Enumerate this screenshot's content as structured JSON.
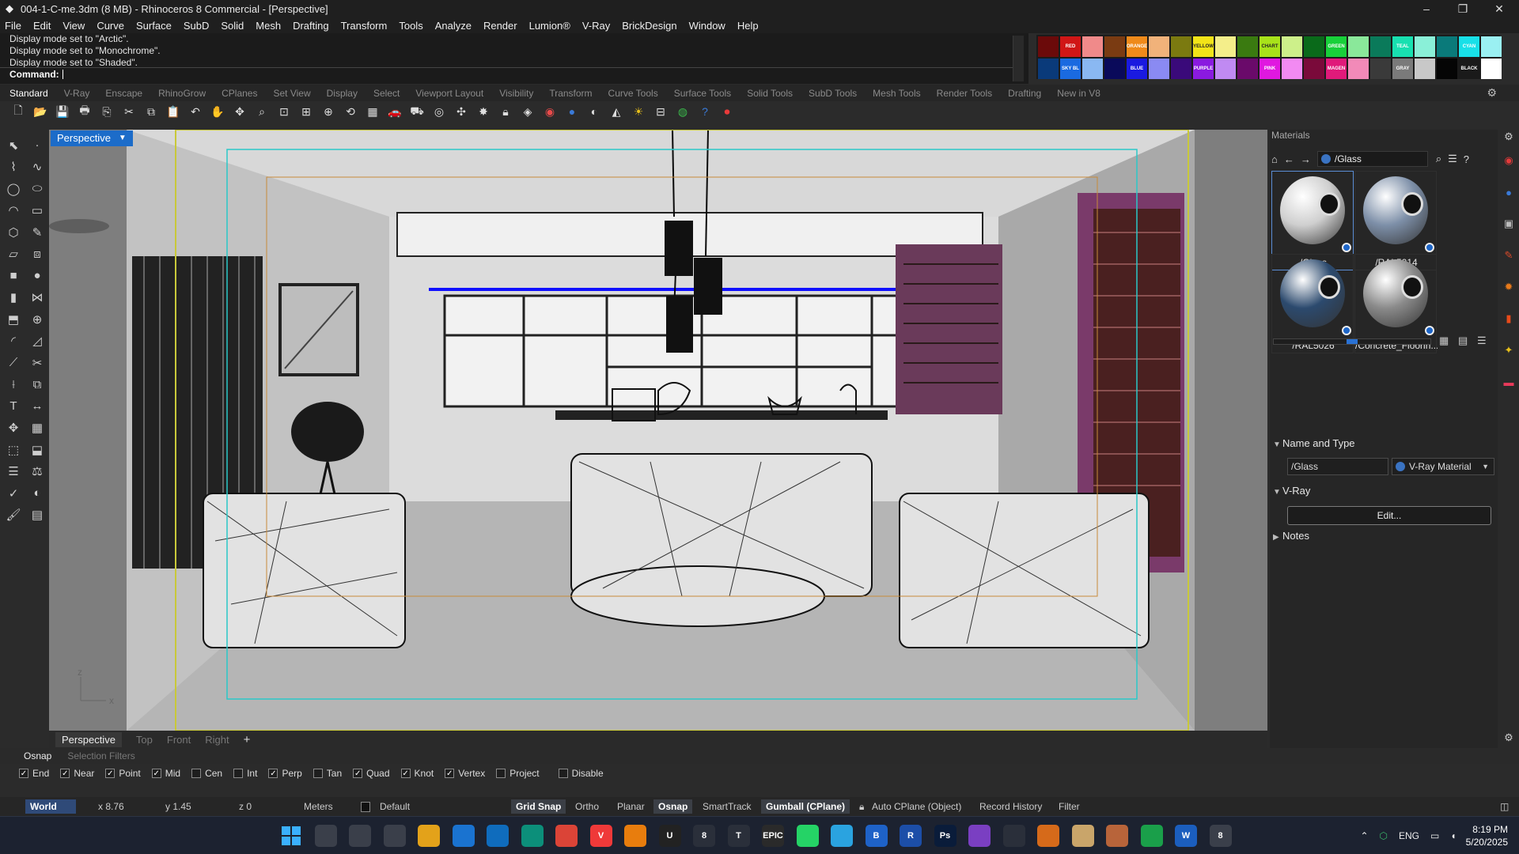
{
  "window": {
    "title": "004-1-C-me.3dm (8 MB) - Rhinoceros 8 Commercial - [Perspective]",
    "controls": [
      "–",
      "❐",
      "✕"
    ]
  },
  "menu": [
    "File",
    "Edit",
    "View",
    "Curve",
    "Surface",
    "SubD",
    "Solid",
    "Mesh",
    "Drafting",
    "Transform",
    "Tools",
    "Analyze",
    "Render",
    "Lumion®",
    "V-Ray",
    "BrickDesign",
    "Window",
    "Help"
  ],
  "command": {
    "history": [
      "Display mode set to \"Arctic\".",
      "Display mode set to \"Monochrome\".",
      "Display mode set to \"Shaded\"."
    ],
    "prompt": "Command:"
  },
  "swatches": {
    "row1": [
      {
        "c": "#6b0a0a",
        "t": ""
      },
      {
        "c": "#d01616",
        "t": "RED"
      },
      {
        "c": "#f08a8a",
        "t": ""
      },
      {
        "c": "#7a3b12",
        "t": ""
      },
      {
        "c": "#ef8a1a",
        "t": "ORANGE"
      },
      {
        "c": "#f1b27a",
        "t": ""
      },
      {
        "c": "#7b7a10",
        "t": ""
      },
      {
        "c": "#f2e418",
        "t": "YELLOW"
      },
      {
        "c": "#f4ee8a",
        "t": ""
      },
      {
        "c": "#3a7a10",
        "t": ""
      },
      {
        "c": "#a8e21a",
        "t": "CHART"
      },
      {
        "c": "#cdf08a",
        "t": ""
      },
      {
        "c": "#0a6a1a",
        "t": ""
      },
      {
        "c": "#18d03a",
        "t": "GREEN"
      },
      {
        "c": "#8ae89a",
        "t": ""
      },
      {
        "c": "#0a7a5a",
        "t": ""
      },
      {
        "c": "#18e0b0",
        "t": "TEAL"
      },
      {
        "c": "#8af0d8",
        "t": ""
      },
      {
        "c": "#0a7a7a",
        "t": ""
      },
      {
        "c": "#18e0e8",
        "t": "CYAN"
      },
      {
        "c": "#9af0f2",
        "t": ""
      }
    ],
    "row2": [
      {
        "c": "#0a3a7a",
        "t": ""
      },
      {
        "c": "#1a6ae0",
        "t": "SKY BL"
      },
      {
        "c": "#8ab8f2",
        "t": ""
      },
      {
        "c": "#0a0a5a",
        "t": ""
      },
      {
        "c": "#1a1ae0",
        "t": "BLUE"
      },
      {
        "c": "#8a8af2",
        "t": ""
      },
      {
        "c": "#3a0a7a",
        "t": ""
      },
      {
        "c": "#8a1ae0",
        "t": "PURPLE"
      },
      {
        "c": "#c08af2",
        "t": ""
      },
      {
        "c": "#6a0a6a",
        "t": ""
      },
      {
        "c": "#e018e0",
        "t": "PINK"
      },
      {
        "c": "#f28af2",
        "t": ""
      },
      {
        "c": "#7a0a3a",
        "t": ""
      },
      {
        "c": "#e01a7a",
        "t": "MAGEN"
      },
      {
        "c": "#f28ab8",
        "t": ""
      },
      {
        "c": "#3a3a3a",
        "t": ""
      },
      {
        "c": "#7a7a7a",
        "t": "GRAY"
      },
      {
        "c": "#c8c8c8",
        "t": ""
      },
      {
        "c": "#050505",
        "t": ""
      },
      {
        "c": "#1a1a1a",
        "t": "BLACK"
      },
      {
        "c": "#ffffff",
        "t": ""
      }
    ]
  },
  "toolbar_tabs": {
    "items": [
      "Standard",
      "V-Ray",
      "Enscape",
      "RhinoGrow",
      "CPlanes",
      "Set View",
      "Display",
      "Select",
      "Viewport Layout",
      "Visibility",
      "Transform",
      "Curve Tools",
      "Surface Tools",
      "Solid Tools",
      "SubD Tools",
      "Mesh Tools",
      "Render Tools",
      "Drafting",
      "New in V8"
    ],
    "active": "Standard"
  },
  "toolbar_icons": [
    "new-file-icon",
    "open-icon",
    "save-icon",
    "print-icon",
    "import-icon",
    "cut-icon",
    "copy-icon",
    "paste-icon",
    "undo-icon",
    "pan-icon",
    "move-view-icon",
    "zoom-icon",
    "zoom-window-icon",
    "zoom-extents-icon",
    "zoom-selected-icon",
    "rotate-view-icon",
    "four-viewports-icon",
    "car-icon",
    "car-wire-icon",
    "named-view-icon",
    "osnap-icon",
    "light-icon",
    "lock-icon",
    "material-icon",
    "color-wheel-icon",
    "sphere-icon",
    "render-icon",
    "gradient-icon",
    "sun-icon",
    "layout-icon",
    "rhino-globe-icon",
    "help-icon",
    "record-icon"
  ],
  "viewport": {
    "name": "Perspective",
    "axis_z": "z",
    "axis_x": "x"
  },
  "view_tabs": {
    "items": [
      "Perspective",
      "Top",
      "Front",
      "Right"
    ],
    "active": "Perspective",
    "add": "+"
  },
  "materials_panel": {
    "title": "Materials",
    "current": "/Glass",
    "materials": [
      {
        "name": "/Glass",
        "color": "#cfcfcf",
        "selected": true
      },
      {
        "name": "/RAL5014",
        "color": "#7d8fa8",
        "selected": false
      },
      {
        "name": "/RAL5026",
        "color": "#2c4a6e",
        "selected": false
      },
      {
        "name": "/Concrete_Floorin...",
        "color": "#8a8a8a",
        "selected": false
      }
    ],
    "section_name_type": "Name and Type",
    "name_field": "/Glass",
    "type_field": "V-Ray Material",
    "section_vray": "V-Ray",
    "edit_button": "Edit...",
    "section_notes": "Notes"
  },
  "osnap_tabs": {
    "items": [
      "Osnap",
      "Selection Filters"
    ],
    "active": "Osnap"
  },
  "osnaps": [
    {
      "label": "End",
      "checked": true
    },
    {
      "label": "Near",
      "checked": true
    },
    {
      "label": "Point",
      "checked": true
    },
    {
      "label": "Mid",
      "checked": true
    },
    {
      "label": "Cen",
      "checked": false
    },
    {
      "label": "Int",
      "checked": false
    },
    {
      "label": "Perp",
      "checked": true
    },
    {
      "label": "Tan",
      "checked": false
    },
    {
      "label": "Quad",
      "checked": true
    },
    {
      "label": "Knot",
      "checked": true
    },
    {
      "label": "Vertex",
      "checked": true
    },
    {
      "label": "Project",
      "checked": false
    },
    {
      "label": "Disable",
      "checked": false
    }
  ],
  "status": {
    "cplane": "World",
    "x": "x 8.76",
    "y": "y 1.45",
    "z": "z 0",
    "units": "Meters",
    "layer": "Default",
    "grid_snap": "Grid Snap",
    "ortho": "Ortho",
    "planar": "Planar",
    "osnap": "Osnap",
    "smarttrack": "SmartTrack",
    "gumball": "Gumball (CPlane)",
    "auto_cplane": "Auto CPlane (Object)",
    "record_history": "Record History",
    "filter": "Filter"
  },
  "taskbar": {
    "apps": [
      {
        "icon": "windows-start-icon",
        "label": "",
        "color": "#2b88d8"
      },
      {
        "icon": "task-view-icon",
        "label": "",
        "color": "#3a3f4a"
      },
      {
        "icon": "cube-app-icon",
        "label": "",
        "color": "#3a3f4a"
      },
      {
        "icon": "browser-ring-icon",
        "label": "",
        "color": "#3a3f4a"
      },
      {
        "icon": "file-explorer-icon",
        "label": "",
        "color": "#e3a21a"
      },
      {
        "icon": "store-icon",
        "label": "",
        "color": "#1a73d0"
      },
      {
        "icon": "outlook-icon",
        "label": "",
        "color": "#0f6cbd"
      },
      {
        "icon": "edge-icon",
        "label": "",
        "color": "#0c8f7a"
      },
      {
        "icon": "chrome-icon",
        "label": "",
        "color": "#db4437"
      },
      {
        "icon": "vivaldi-icon",
        "label": "V",
        "color": "#ef3939"
      },
      {
        "icon": "blender-icon",
        "label": "",
        "color": "#e87d0d"
      },
      {
        "icon": "unreal-icon",
        "label": "U",
        "color": "#222222"
      },
      {
        "icon": "sketchup-icon",
        "label": "8",
        "color": "#2a2f3a"
      },
      {
        "icon": "t-app-icon",
        "label": "T",
        "color": "#2a2f3a"
      },
      {
        "icon": "epic-games-icon",
        "label": "EPIC",
        "color": "#2a2a2a"
      },
      {
        "icon": "whatsapp-icon",
        "label": "",
        "color": "#25d366"
      },
      {
        "icon": "telegram-icon",
        "label": "",
        "color": "#2aa3e0"
      },
      {
        "icon": "blue-b-icon",
        "label": "B",
        "color": "#1e62c8"
      },
      {
        "icon": "revit-icon",
        "label": "R",
        "color": "#1c4ea8"
      },
      {
        "icon": "photoshop-icon",
        "label": "Ps",
        "color": "#0a1c3a"
      },
      {
        "icon": "purple-hex-icon",
        "label": "",
        "color": "#7a3fc2"
      },
      {
        "icon": "location-icon",
        "label": "",
        "color": "#2a2f3a"
      },
      {
        "icon": "orange-circle-icon",
        "label": "",
        "color": "#d66a1a"
      },
      {
        "icon": "folder-people-icon",
        "label": "",
        "color": "#c9a56a"
      },
      {
        "icon": "box-3d-icon",
        "label": "",
        "color": "#b8643a"
      },
      {
        "icon": "chrome-profile-icon",
        "label": "",
        "color": "#1a9f4a"
      },
      {
        "icon": "word-icon",
        "label": "W",
        "color": "#1b5ebe"
      },
      {
        "icon": "rhino-icon",
        "label": "8",
        "color": "#3a3f4a"
      }
    ],
    "tray": {
      "lang": "ENG",
      "time": "8:19 PM",
      "date": "5/20/2025"
    }
  }
}
